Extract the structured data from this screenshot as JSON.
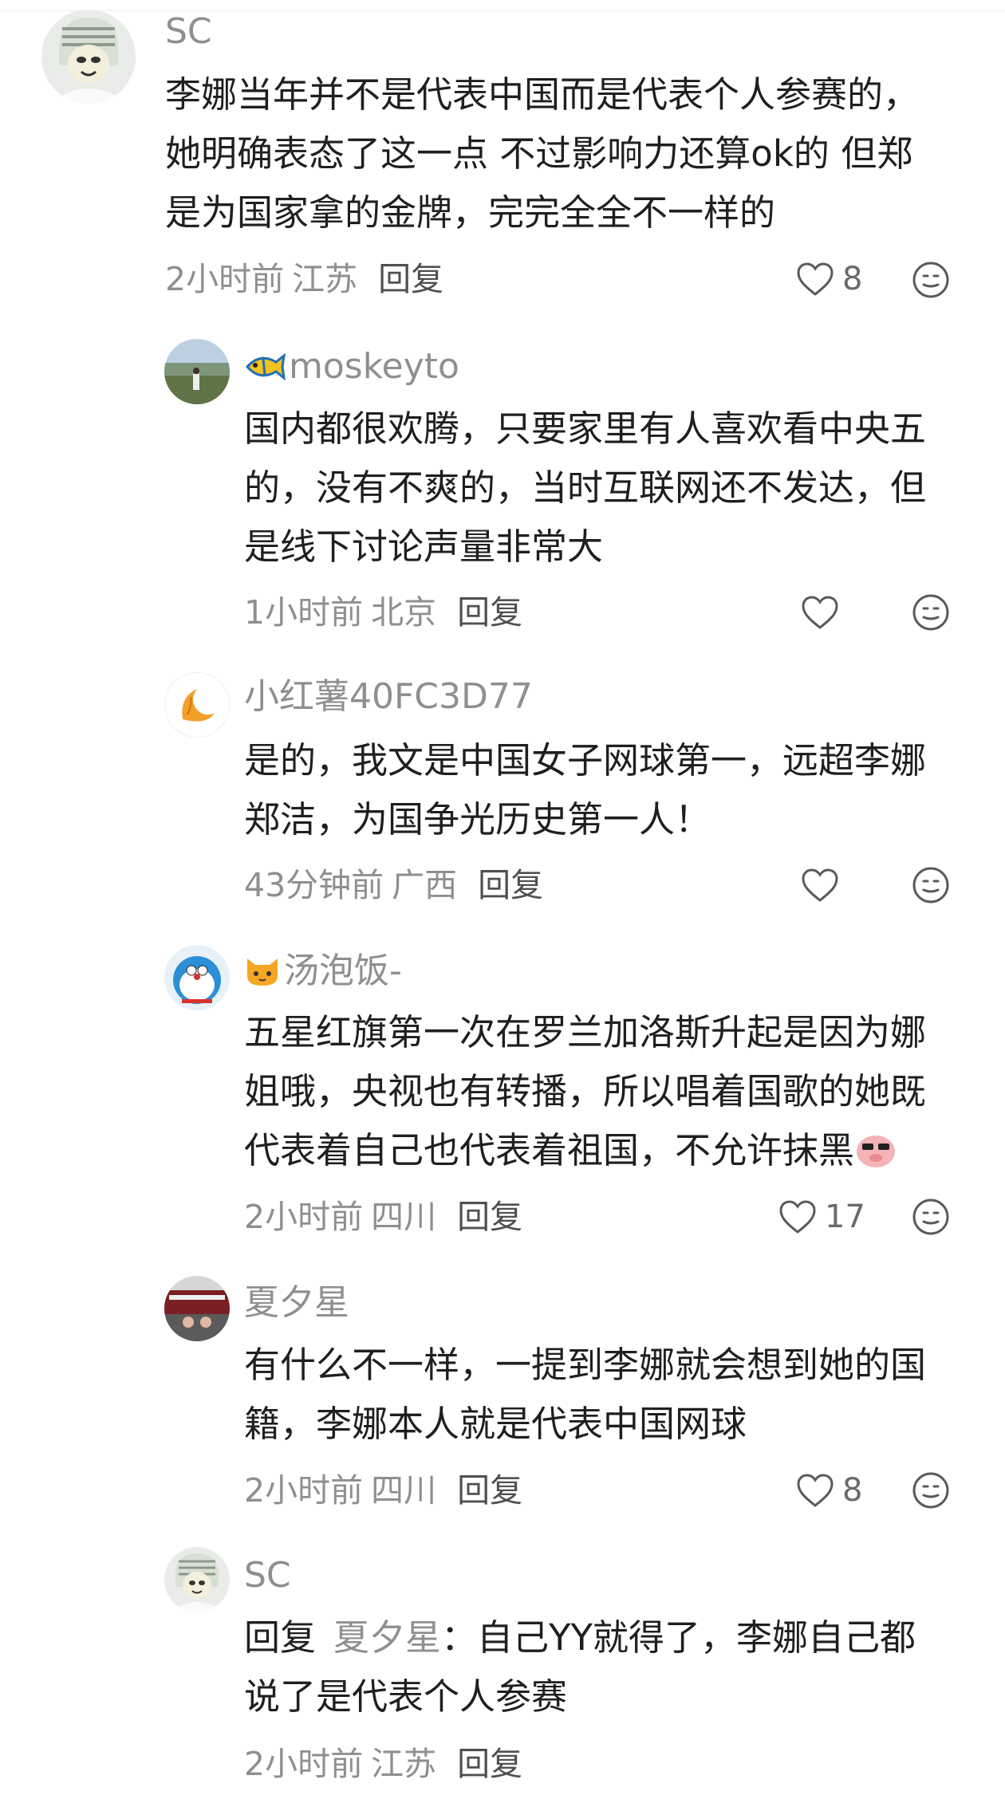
{
  "comments": [
    {
      "author": "SC",
      "lines": [
        "李娜当年并不是代表中国而是代表个人参赛的，",
        "她明确表态了这一点 不过影响力还算ok的 但郑",
        "是为国家拿的金牌，完完全全不一样的"
      ],
      "time": "2小时前",
      "location": "江苏",
      "reply_label": "回复",
      "likes": "8"
    },
    {
      "author": "moskeyto",
      "author_emoji": "fish-emoji",
      "lines": [
        "国内都很欢腾，只要家里有人喜欢看中央五",
        "的，没有不爽的，当时互联网还不发达，但",
        "是线下讨论声量非常大"
      ],
      "time": "1小时前",
      "location": "北京",
      "reply_label": "回复",
      "likes": ""
    },
    {
      "author": "小红薯40FC3D77",
      "lines": [
        "是的，我文是中国女子网球第一，远超李娜",
        "郑洁，为国争光历史第一人！"
      ],
      "time": "43分钟前",
      "location": "广西",
      "reply_label": "回复",
      "likes": ""
    },
    {
      "author": "汤泡饭-",
      "author_emoji": "cat-emoji",
      "lines": [
        "五星红旗第一次在罗兰加洛斯升起是因为娜",
        "姐哦，央视也有转播，所以唱着国歌的她既",
        "代表着自己也代表着祖国，不允许抹黑"
      ],
      "time": "2小时前",
      "location": "四川",
      "reply_label": "回复",
      "likes": "17"
    },
    {
      "author": "夏夕星",
      "lines": [
        "有什么不一样，一提到李娜就会想到她的国",
        "籍，李娜本人就是代表中国网球"
      ],
      "time": "2小时前",
      "location": "四川",
      "reply_label": "回复",
      "likes": "8"
    },
    {
      "author": "SC",
      "reply_prefix": "回复",
      "reply_to": "夏夕星",
      "reply_colon": "：",
      "lines": [
        "自己YY就得了，李娜自己都",
        "说了是代表个人参赛"
      ],
      "time": "2小时前",
      "location": "江苏",
      "reply_label": "回复",
      "likes": ""
    }
  ],
  "icons": {
    "like": "heart-outline-icon",
    "react": "smile-face-icon",
    "sticker": "pig-sticker-emoji"
  },
  "colors": {
    "muted_text": "#8f8f8f",
    "body_text": "#1f1f1f",
    "icon_stroke": "#5a5a5a"
  }
}
